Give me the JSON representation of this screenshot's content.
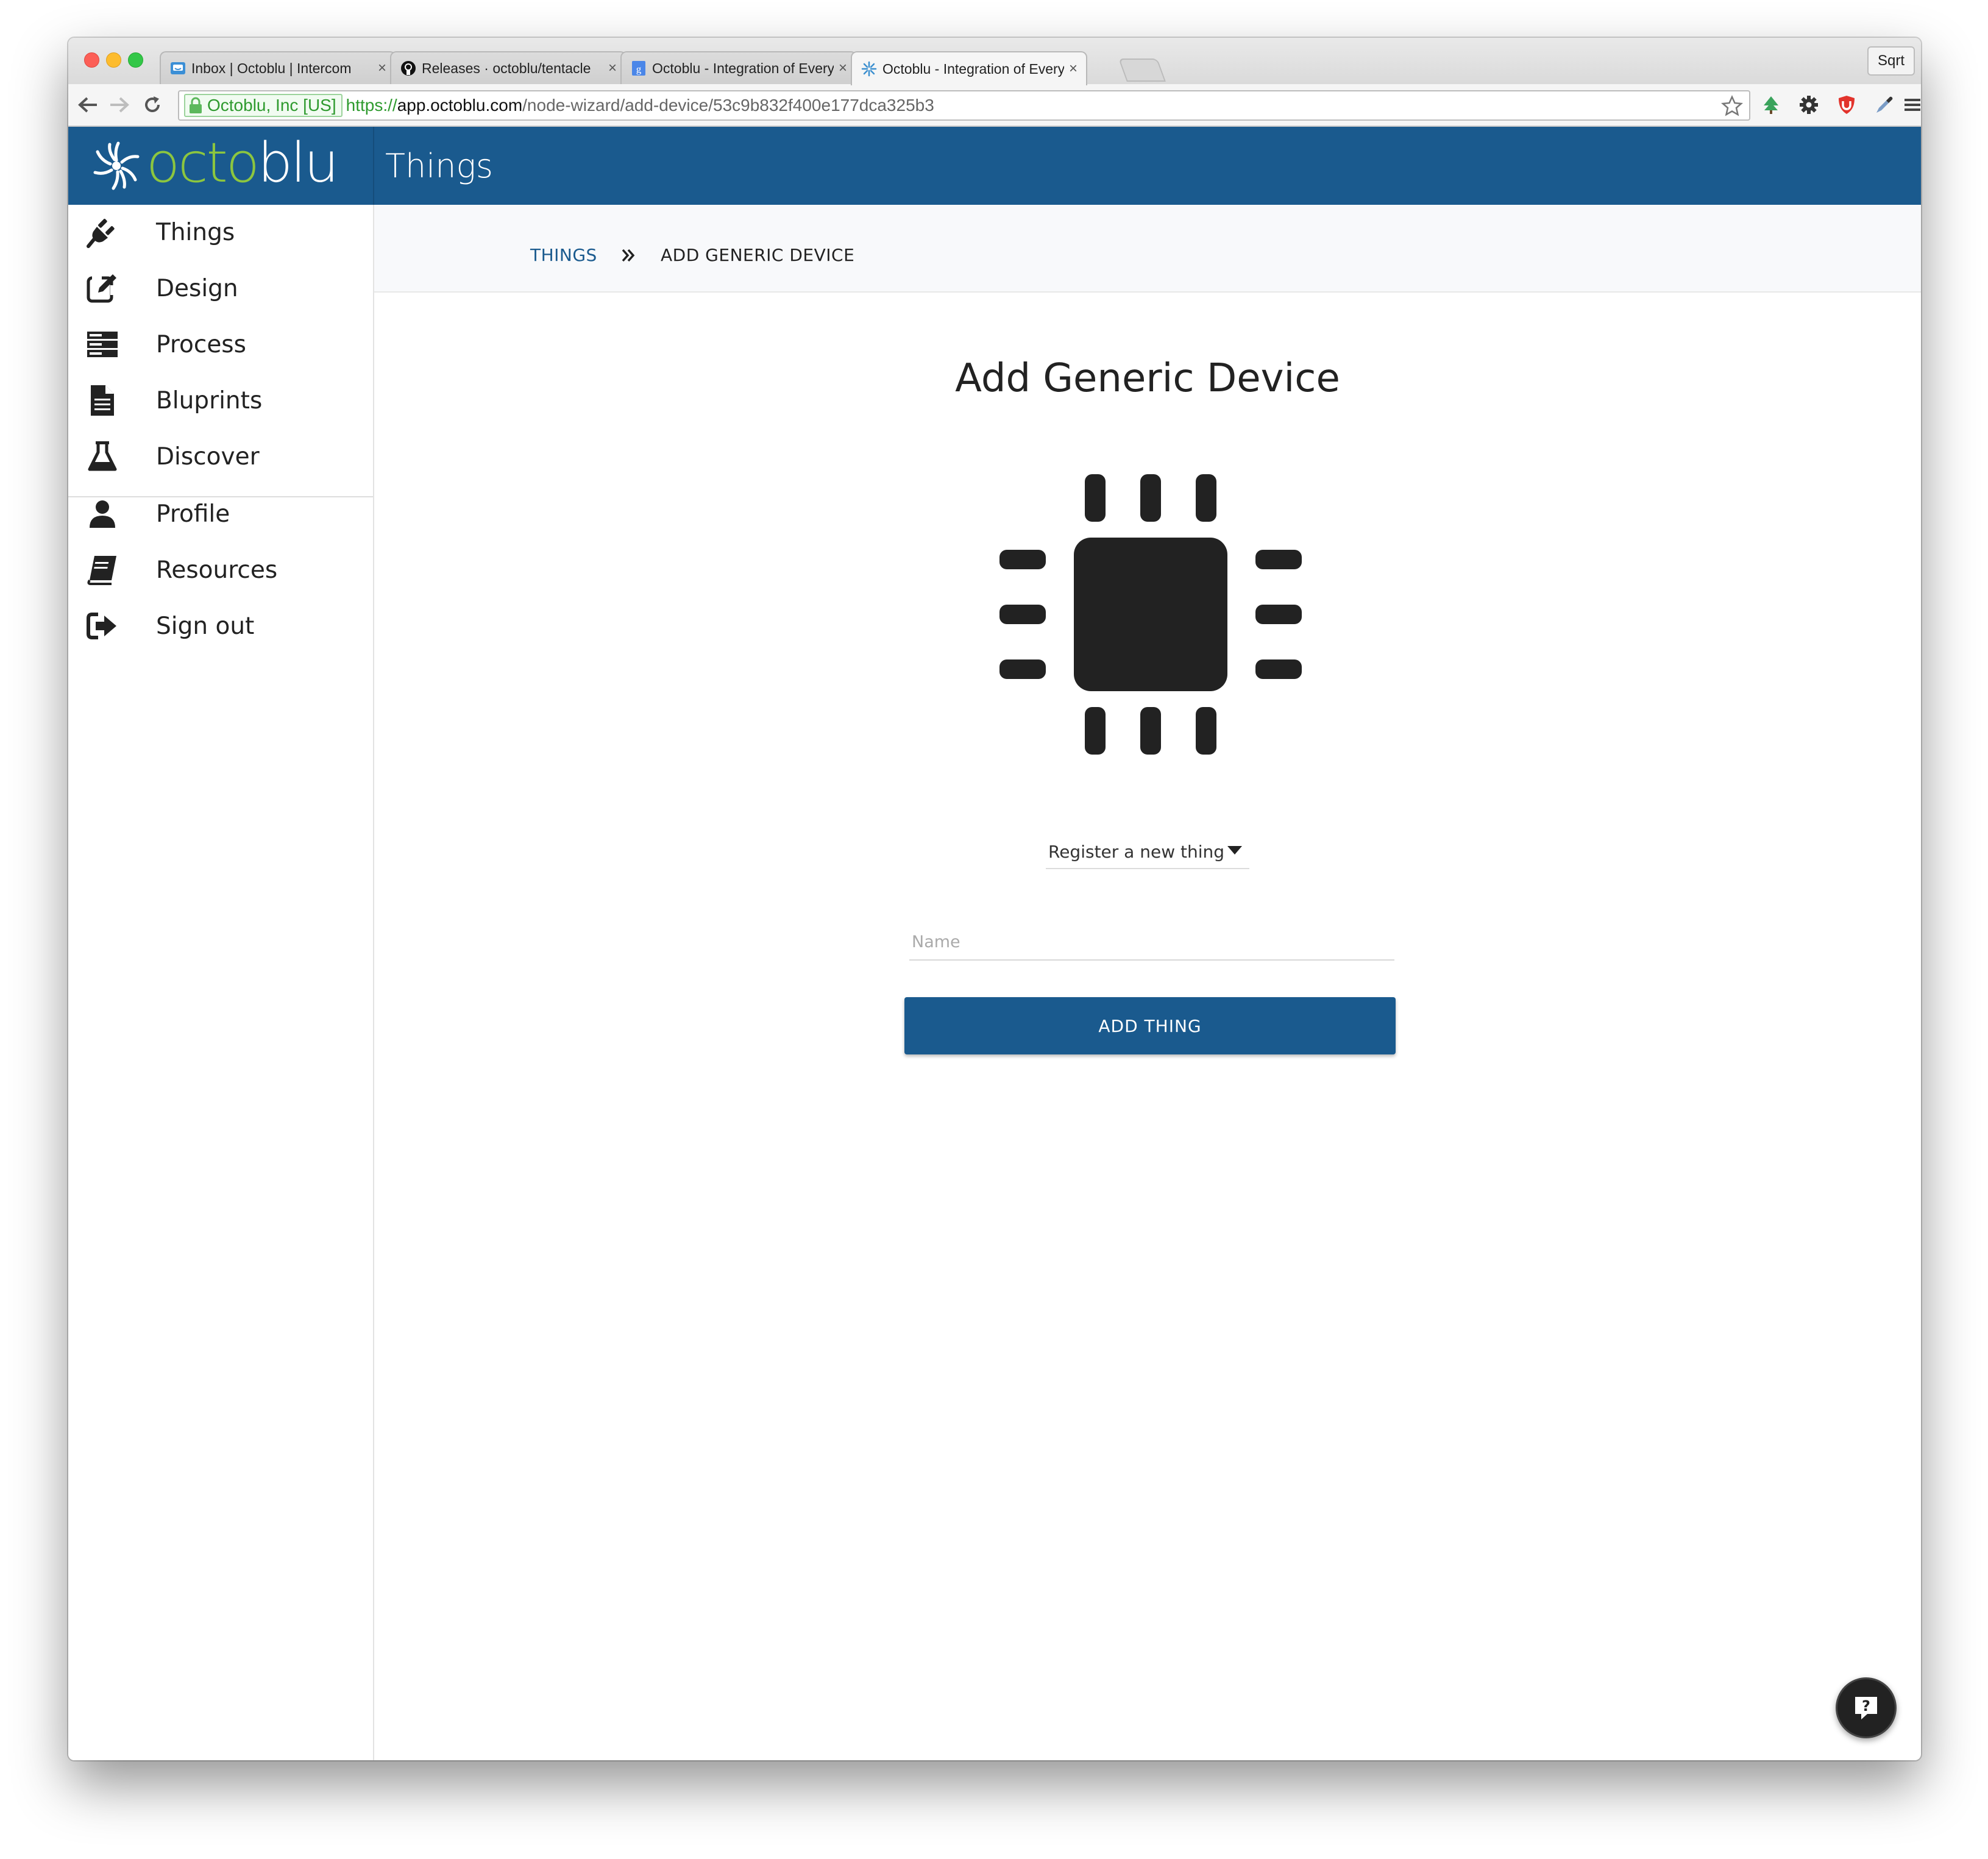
{
  "browser": {
    "tabs": [
      {
        "title": "Inbox | Octoblu | Intercom",
        "active": false,
        "favicon": "intercom-icon"
      },
      {
        "title": "Releases · octoblu/tentacle",
        "active": false,
        "favicon": "github-icon"
      },
      {
        "title": "Octoblu - Integration of Every",
        "active": false,
        "favicon": "google-docs-icon"
      },
      {
        "title": "Octoblu - Integration of Every",
        "active": true,
        "favicon": "octoblu-icon"
      }
    ],
    "close_glyph": "×",
    "profile_name": "Sqrt",
    "address": {
      "ev_label": "Octoblu, Inc [US]",
      "scheme": "https://",
      "host": "app.octoblu.com",
      "path": "/node-wizard/add-device/53c9b832f400e177dca325b3"
    },
    "extension_badge": "4"
  },
  "header": {
    "logo_part1": "octo",
    "logo_part2": "blu",
    "title": "Things"
  },
  "sidebar": {
    "items": [
      {
        "label": "Things",
        "icon": "plug-icon"
      },
      {
        "label": "Design",
        "icon": "edit-icon"
      },
      {
        "label": "Process",
        "icon": "server-icon"
      },
      {
        "label": "Bluprints",
        "icon": "document-icon"
      },
      {
        "label": "Discover",
        "icon": "flask-icon"
      },
      {
        "label": "Profile",
        "icon": "user-icon"
      },
      {
        "label": "Resources",
        "icon": "book-icon"
      },
      {
        "label": "Sign out",
        "icon": "sign-out-icon"
      }
    ]
  },
  "breadcrumb": {
    "link": "THINGS",
    "current": "ADD GENERIC DEVICE"
  },
  "main": {
    "title": "Add Generic Device",
    "device_icon": "chip-icon",
    "select_value": "Register a new thing",
    "name_placeholder": "Name",
    "name_value": "",
    "add_button_label": "ADD THING"
  },
  "colors": {
    "brand_blue": "#1a5a8e",
    "logo_green": "#8cc63f",
    "secure_green": "#2e9a2e"
  }
}
